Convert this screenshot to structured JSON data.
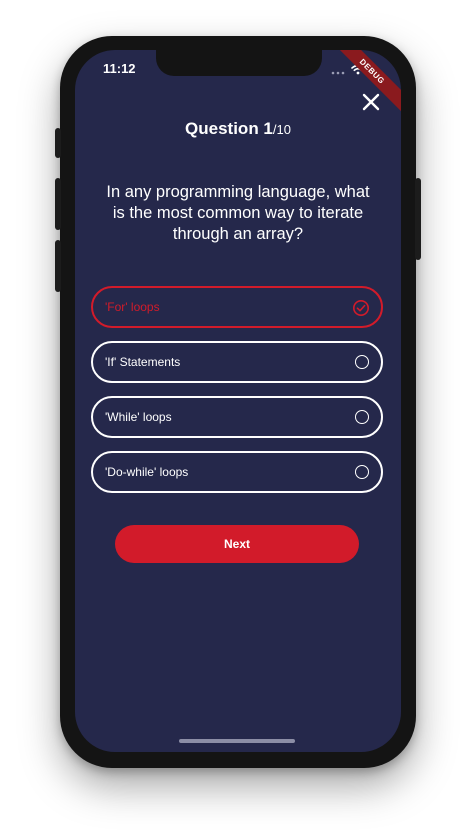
{
  "status_bar": {
    "time": "11:12"
  },
  "debug_banner": "DEBUG",
  "header": {
    "question_label": "Question 1",
    "question_total": "/10"
  },
  "question": {
    "text": "In any programming language, what is the most common way to iterate through an array?"
  },
  "options": [
    {
      "label": "'For' loops",
      "selected": true
    },
    {
      "label": "'If' Statements",
      "selected": false
    },
    {
      "label": "'While' loops",
      "selected": false
    },
    {
      "label": "'Do-while' loops",
      "selected": false
    }
  ],
  "next_button": {
    "label": "Next"
  },
  "colors": {
    "background": "#25284b",
    "accent": "#d21b2a",
    "text": "#ffffff"
  }
}
